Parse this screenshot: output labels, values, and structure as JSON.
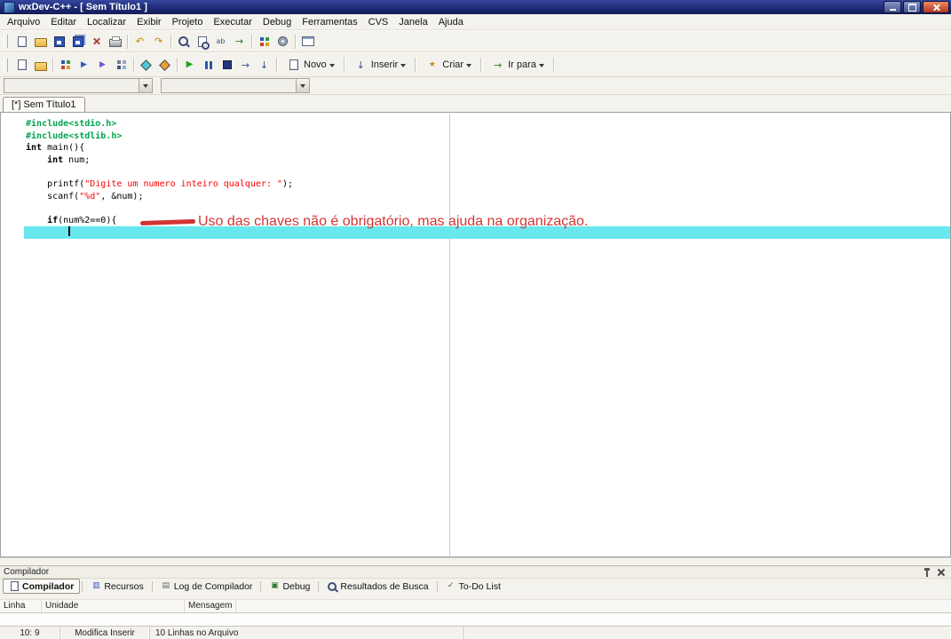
{
  "window": {
    "title": "wxDev-C++ - [ Sem Título1 ]"
  },
  "menu": {
    "items": [
      "Arquivo",
      "Editar",
      "Localizar",
      "Exibir",
      "Projeto",
      "Executar",
      "Debug",
      "Ferramentas",
      "CVS",
      "Janela",
      "Ajuda"
    ]
  },
  "toolbars": {
    "main": [
      "new-file",
      "open-file",
      "save",
      "save-all",
      "close-file",
      "print",
      "|",
      "undo",
      "redo",
      "|",
      "find",
      "find-in-files",
      "replace",
      "goto-line",
      "|",
      "new-project",
      "project-options",
      "|",
      "window-layout"
    ],
    "build": [
      "new-source",
      "open-project",
      "|",
      "compile",
      "run",
      "compile-and-run",
      "rebuild-all",
      "|",
      "debug",
      "profile",
      "|",
      "continue",
      "pause",
      "stop",
      "next-step",
      "step-into",
      "|"
    ],
    "build_buttons": [
      {
        "label": "Novo",
        "icon": "new-item"
      },
      {
        "label": "Inserir",
        "icon": "insert-item"
      },
      {
        "label": "Criar",
        "icon": "create-item"
      },
      {
        "label": "Ir para",
        "icon": "goto-item"
      }
    ]
  },
  "browser": {
    "class_combo": {
      "value": ""
    },
    "member_combo": {
      "value": ""
    }
  },
  "tabs": [
    {
      "label": "[*] Sem Título1",
      "active": true
    }
  ],
  "editor": {
    "lines": [
      {
        "segments": [
          {
            "t": "#include<stdio.h>",
            "s": "pre"
          }
        ]
      },
      {
        "segments": [
          {
            "t": "#include<stdlib.h>",
            "s": "pre"
          }
        ]
      },
      {
        "segments": [
          {
            "t": "int",
            "s": "kw"
          },
          {
            "t": " main(){",
            "s": "pl"
          }
        ]
      },
      {
        "segments": [
          {
            "t": "    ",
            "s": "pl"
          },
          {
            "t": "int",
            "s": "kw"
          },
          {
            "t": " num;",
            "s": "pl"
          }
        ]
      },
      {
        "segments": []
      },
      {
        "segments": [
          {
            "t": "    printf(",
            "s": "pl"
          },
          {
            "t": "\"Digite um numero inteiro qualquer: \"",
            "s": "str"
          },
          {
            "t": ");",
            "s": "pl"
          }
        ]
      },
      {
        "segments": [
          {
            "t": "    scanf(",
            "s": "pl"
          },
          {
            "t": "\"%d\"",
            "s": "str"
          },
          {
            "t": ", &num);",
            "s": "pl"
          }
        ]
      },
      {
        "segments": []
      },
      {
        "segments": [
          {
            "t": "    ",
            "s": "pl"
          },
          {
            "t": "if",
            "s": "kw"
          },
          {
            "t": "(num%2==0){",
            "s": "pl"
          }
        ]
      },
      {
        "segments": [
          {
            "t": "        ",
            "s": "pl"
          }
        ],
        "highlight": true,
        "caret": true
      }
    ],
    "annotation": {
      "text": "Uso das chaves não é obrigatório, mas ajuda na organização."
    }
  },
  "panel": {
    "title": "Compilador",
    "tabs": [
      {
        "label": "Compilador",
        "icon": "compiler-tab",
        "active": true
      },
      {
        "label": "Recursos",
        "icon": "resources-tab"
      },
      {
        "label": "Log de Compilador",
        "icon": "log-tab"
      },
      {
        "label": "Debug",
        "icon": "debug-tab"
      },
      {
        "label": "Resultados de Busca",
        "icon": "search-results-tab"
      },
      {
        "label": "To-Do List",
        "icon": "todo-tab"
      }
    ],
    "columns": [
      "Linha",
      "Unidade",
      "Mensagem"
    ]
  },
  "statusbar": {
    "cells": [
      "10: 9",
      "Modifica Inserir",
      "10 Linhas no Arquivo"
    ]
  },
  "colors": {
    "selection_line": "#68e8ee",
    "annotation": "#d23434",
    "preprocessor": "#00a651",
    "string": "#ff0000"
  }
}
